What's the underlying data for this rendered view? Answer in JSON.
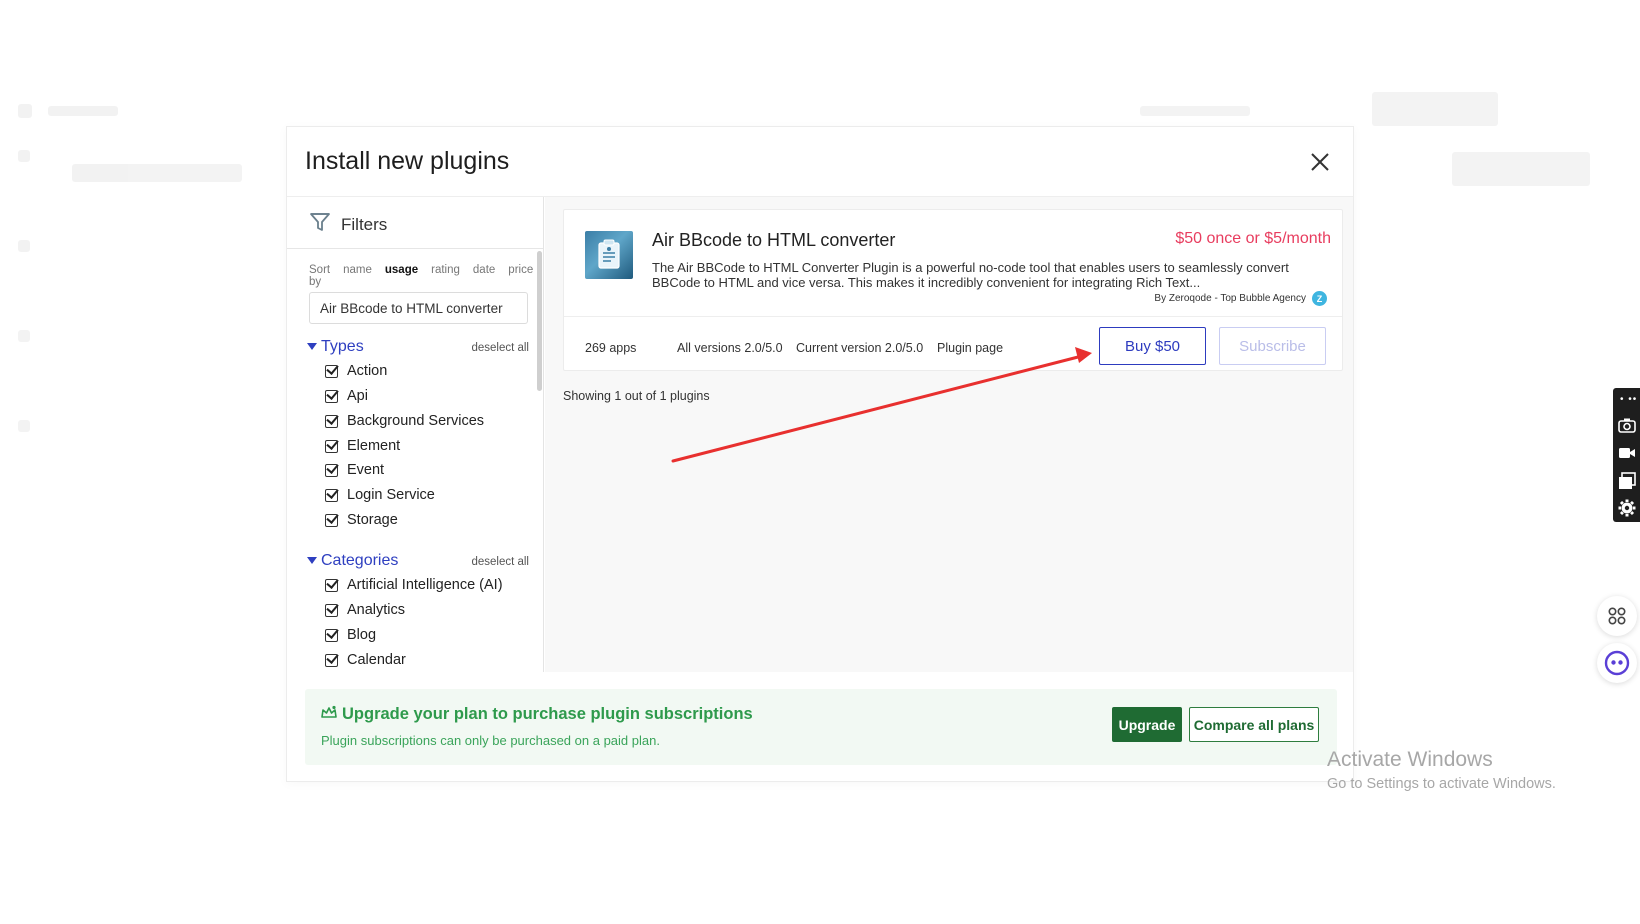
{
  "modal": {
    "title": "Install new plugins",
    "close_icon": "close-icon"
  },
  "filters": {
    "label": "Filters",
    "icon": "funnel-icon",
    "sort_by_label": "Sort by",
    "sort_options": [
      "name",
      "usage",
      "rating",
      "date",
      "price"
    ],
    "active_sort": "usage",
    "search_value": "Air BBcode to HTML converter",
    "types": {
      "title": "Types",
      "deselect": "deselect all",
      "items": [
        "Action",
        "Api",
        "Background Services",
        "Element",
        "Event",
        "Login Service",
        "Storage"
      ]
    },
    "categories": {
      "title": "Categories",
      "deselect": "deselect all",
      "items": [
        "Artificial Intelligence (AI)",
        "Analytics",
        "Blog",
        "Calendar"
      ]
    }
  },
  "plugin": {
    "name": "Air BBcode to HTML converter",
    "price": "$50 once or $5/month",
    "description": "The Air BBCode to HTML Converter Plugin is a powerful no-code tool that enables users to seamlessly convert BBCode to HTML and vice versa. This makes it incredibly convenient for integrating Rich Text...",
    "author": "By Zeroqode - Top Bubble Agency",
    "author_badge": "Z",
    "apps": "269 apps",
    "all_versions": "All versions 2.0/5.0",
    "current_version": "Current version 2.0/5.0",
    "plugin_page": "Plugin page",
    "buy_label": "Buy $50",
    "subscribe_label": "Subscribe"
  },
  "results": {
    "showing": "Showing 1 out of 1 plugins"
  },
  "upgrade": {
    "title": "Upgrade your plan to purchase plugin subscriptions",
    "subtitle": "Plugin subscriptions can only be purchased on a paid plan.",
    "upgrade_label": "Upgrade",
    "compare_label": "Compare all plans"
  },
  "watermark": {
    "title": "Activate Windows",
    "subtitle": "Go to Settings to activate Windows."
  },
  "colors": {
    "accent_blue": "#2d3bbf",
    "price_red": "#e83d5f",
    "success_green": "#2e9a4c",
    "upgrade_dark_green": "#1f6b33",
    "annotation_red": "#e8302f"
  }
}
